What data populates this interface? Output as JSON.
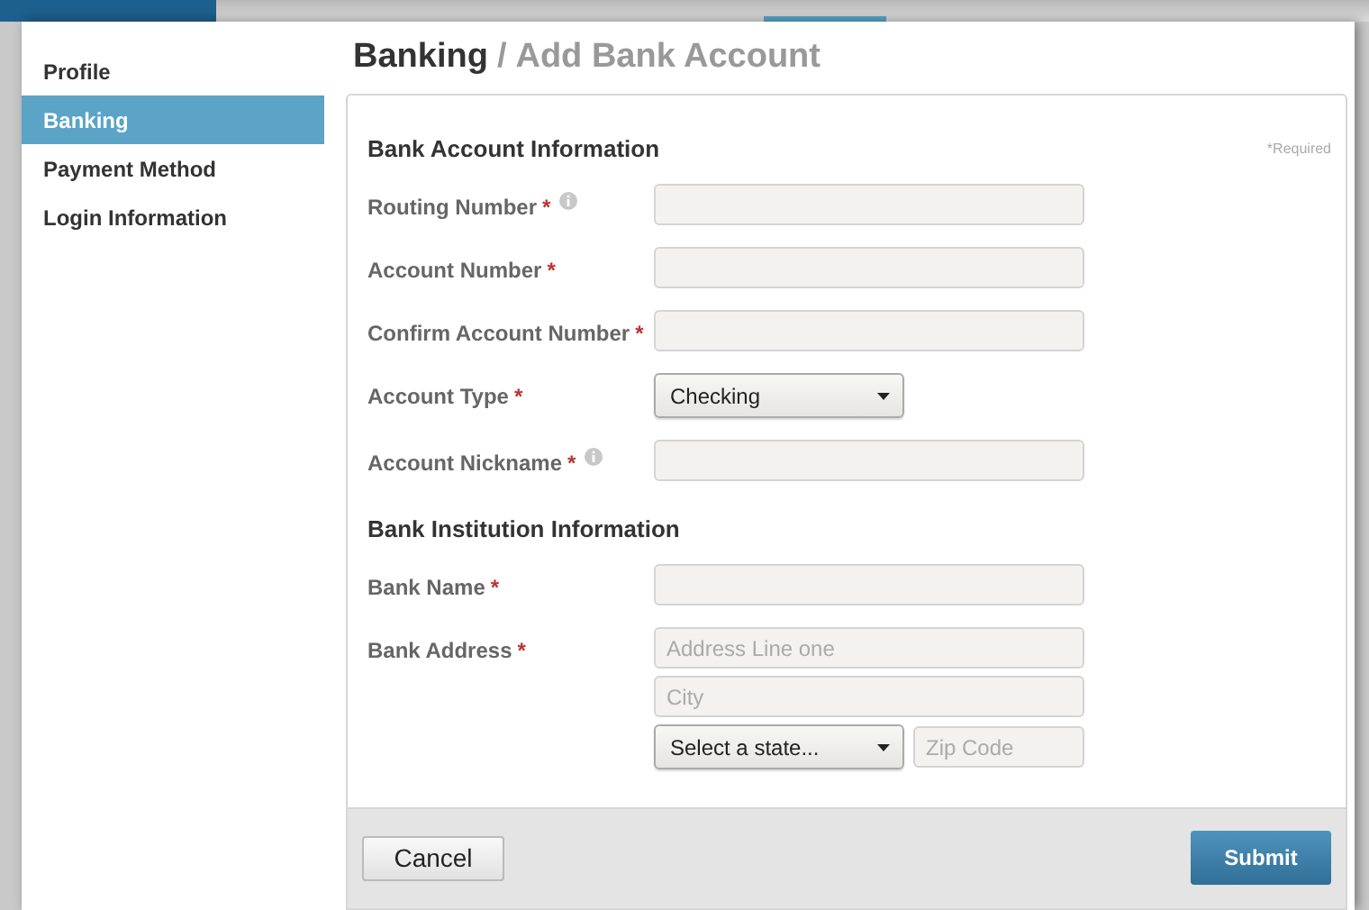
{
  "sidebar": {
    "items": [
      {
        "label": "Profile",
        "selected": false
      },
      {
        "label": "Banking",
        "selected": true
      },
      {
        "label": "Payment Method",
        "selected": false
      },
      {
        "label": "Login Information",
        "selected": false
      }
    ]
  },
  "page_title": {
    "section": "Banking",
    "separator": "/",
    "page": "Add Bank Account"
  },
  "required_note": "*Required",
  "sections": [
    {
      "title": "Bank Account Information",
      "fields": [
        {
          "kind": "text",
          "label": "Routing Number",
          "marker": "*",
          "info": true
        },
        {
          "kind": "text",
          "label": "Account Number",
          "marker": "*",
          "info": false
        },
        {
          "kind": "text",
          "label": "Confirm Account Number",
          "marker": "*",
          "info": false
        },
        {
          "kind": "select",
          "label": "Account Type",
          "marker": "*",
          "info": false,
          "value": "Checking"
        },
        {
          "kind": "text",
          "label": "Account Nickname",
          "marker": "*",
          "info": true
        }
      ]
    },
    {
      "title": "Bank Institution Information",
      "fields": [
        {
          "kind": "text",
          "label": "Bank Name",
          "marker": "*",
          "info": false
        },
        {
          "kind": "address",
          "label": "Bank Address",
          "marker": "*",
          "info": false,
          "line_placeholder": "Address Line one",
          "city_placeholder": "City",
          "state_value": "Select a state...",
          "zip_placeholder": "Zip Code"
        }
      ]
    }
  ],
  "buttons": {
    "cancel": "Cancel",
    "submit": "Submit"
  }
}
